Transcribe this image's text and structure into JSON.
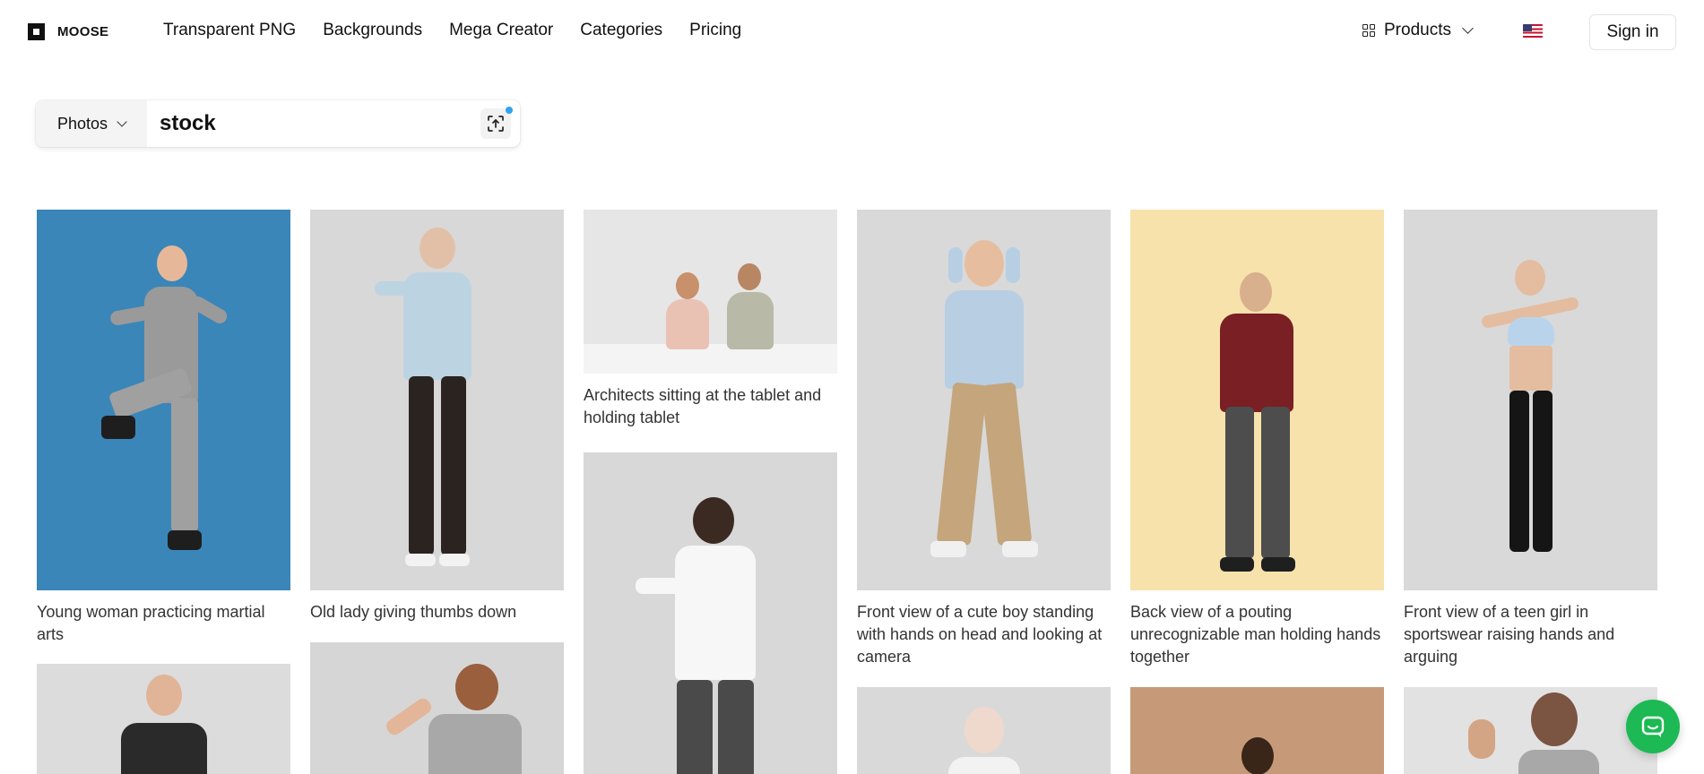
{
  "brand": {
    "name": "MOOSE"
  },
  "nav": {
    "items": [
      "Transparent PNG",
      "Backgrounds",
      "Mega Creator",
      "Categories",
      "Pricing"
    ],
    "products_label": "Products",
    "signin_label": "Sign in"
  },
  "search": {
    "type_label": "Photos",
    "value": "stock"
  },
  "gallery": {
    "items": [
      {
        "caption": "Young woman practicing martial arts"
      },
      {
        "caption": "Old lady giving thumbs down"
      },
      {
        "caption": "Architects sitting at the tablet and holding tablet"
      },
      {
        "caption": "Front view of a cute boy standing with hands on head and looking at camera"
      },
      {
        "caption": "Back view of a pouting unrecognizable man holding hands together"
      },
      {
        "caption": "Front view of a teen girl in sportswear raising hands and arguing"
      }
    ]
  },
  "colors": {
    "accent_blue": "#2ea3f2",
    "chat_green": "#1db954",
    "bg_blue": "#3b86b8",
    "bg_yellow": "#f7e2ac",
    "bg_gray": "#d9d9d9",
    "bg_tan": "#c69a78"
  },
  "icons": {
    "logo": "moose-logo-icon",
    "products": "grid-icon",
    "language": "us-flag-icon",
    "upload": "image-upload-icon",
    "chat": "chat-icon"
  }
}
